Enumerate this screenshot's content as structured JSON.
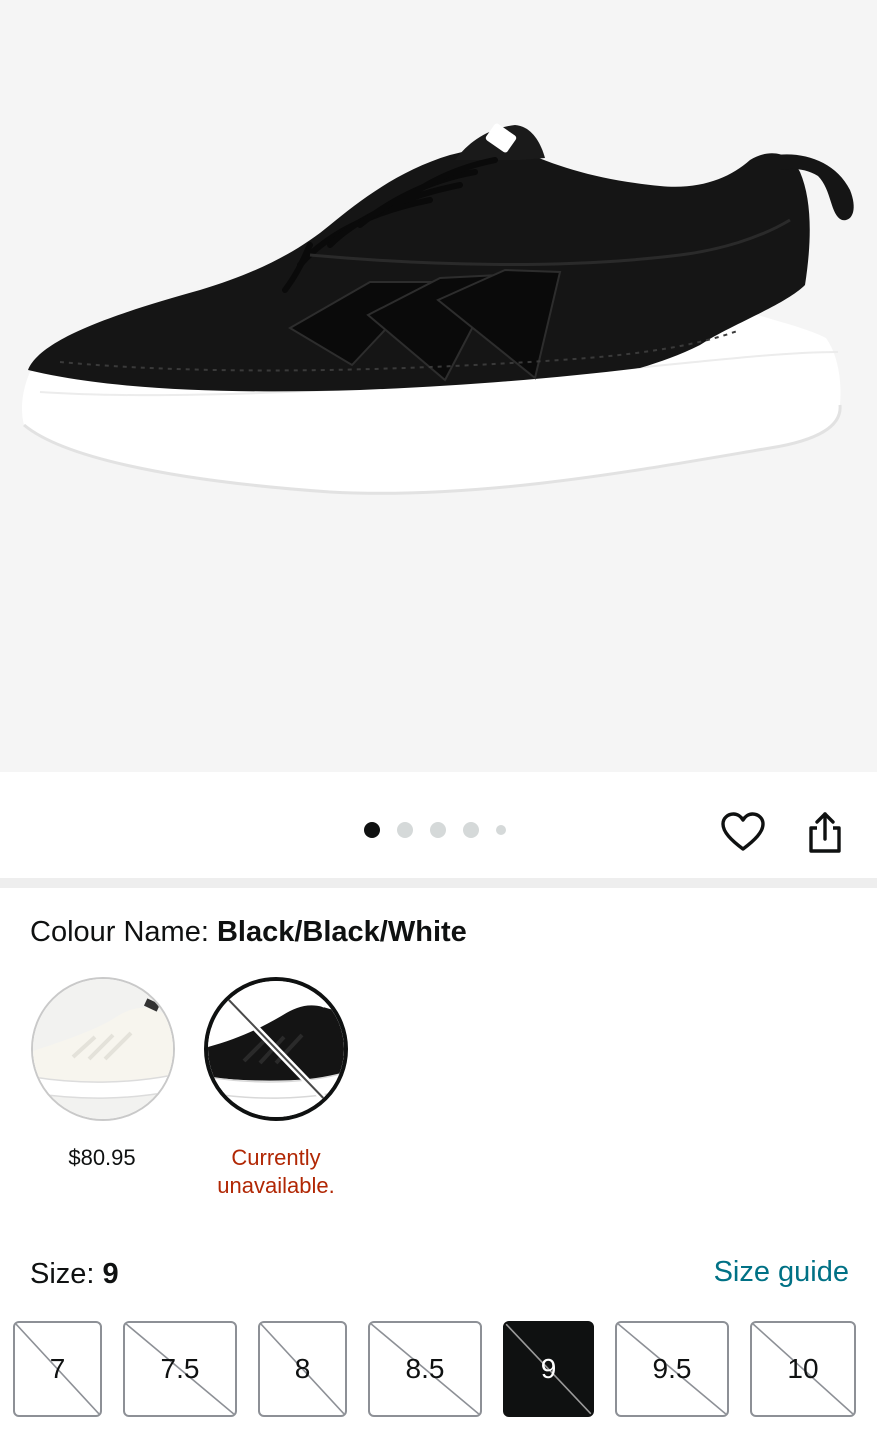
{
  "gallery": {
    "image_alt": "Black canvas low-top sneaker with white platform sole and three stripes",
    "dots": [
      {
        "state": "active"
      },
      {
        "state": "inactive"
      },
      {
        "state": "inactive"
      },
      {
        "state": "inactive"
      },
      {
        "state": "small"
      }
    ],
    "wishlist_icon": "heart-icon",
    "share_icon": "share-icon"
  },
  "colour": {
    "label": "Colour Name: ",
    "value": "Black/Black/White",
    "swatches": [
      {
        "name": "white-variant",
        "price": "$80.95",
        "available": true
      },
      {
        "name": "black-variant",
        "status": "Currently unavailable.",
        "selected": true,
        "available": false
      }
    ]
  },
  "size": {
    "label": "Size: ",
    "value": "9",
    "guide_label": "Size guide",
    "options": [
      "7",
      "7.5",
      "8",
      "8.5",
      "9",
      "9.5",
      "10"
    ],
    "selected": "9"
  },
  "colors": {
    "link": "#007185",
    "unavailable": "#b12704",
    "text": "#0f1111",
    "hero_bg": "#f5f5f5"
  }
}
